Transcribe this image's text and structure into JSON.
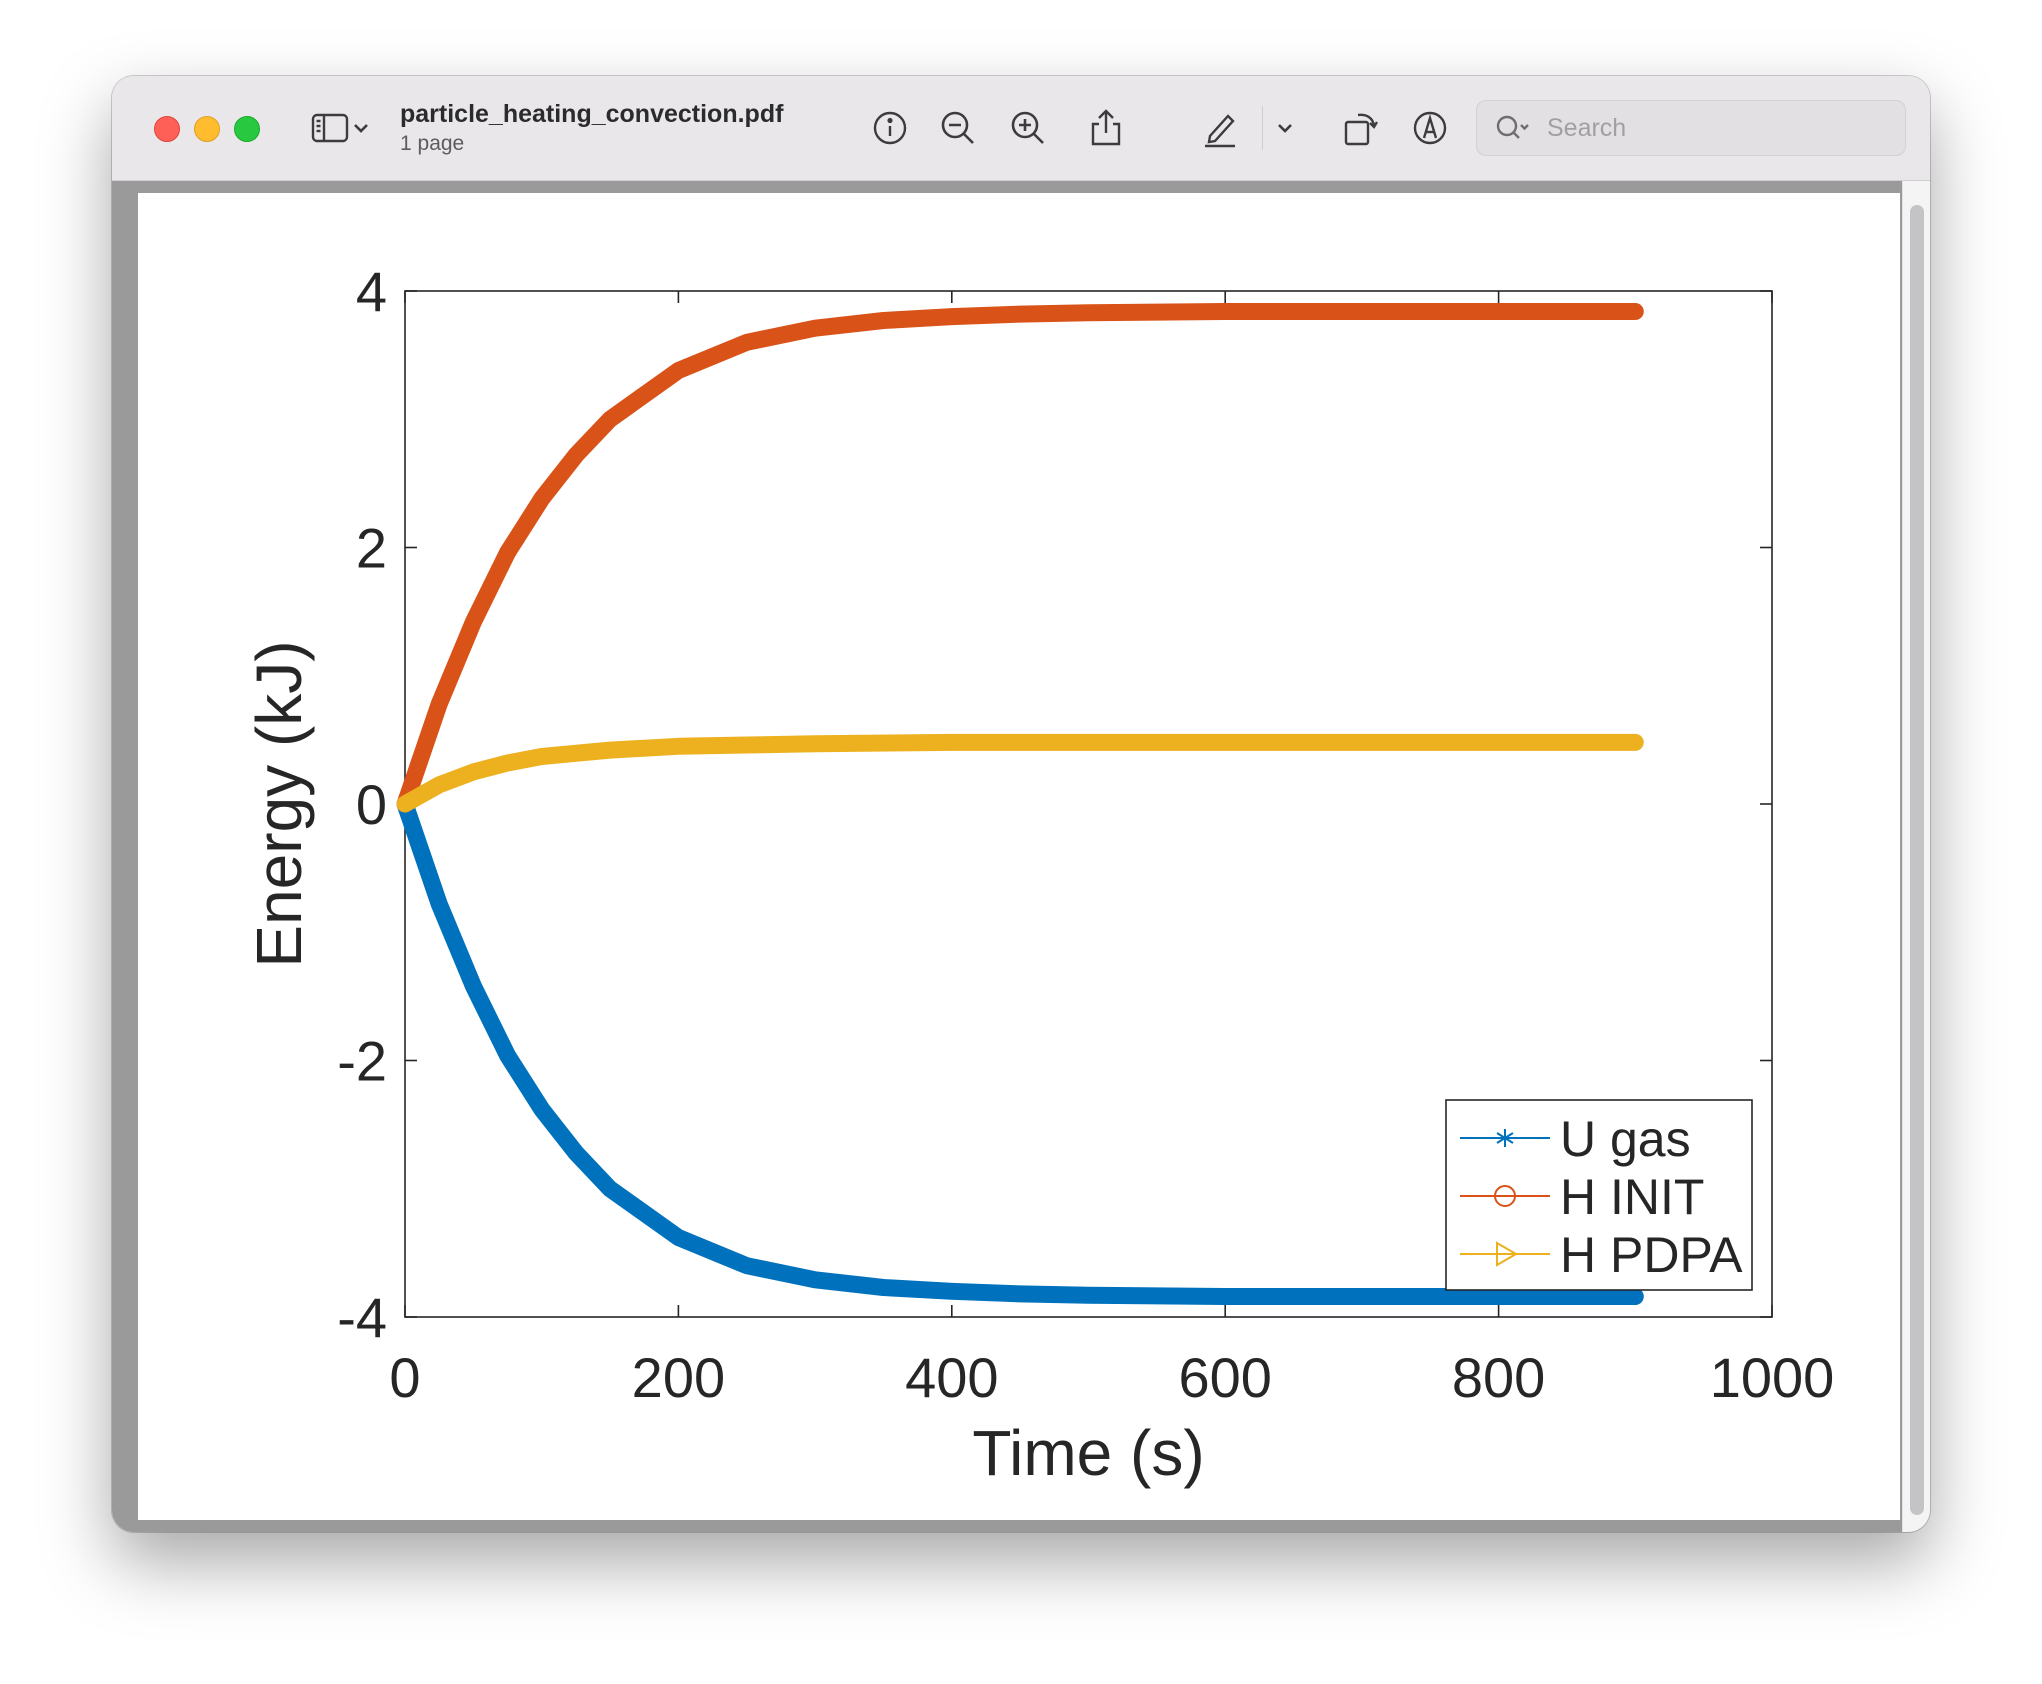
{
  "window": {
    "file_name": "particle_heating_convection.pdf",
    "page_count": "1 page"
  },
  "toolbar": {
    "icons": [
      "sidebar-icon",
      "chevron-down-icon",
      "info-icon",
      "zoom-out-icon",
      "zoom-in-icon",
      "share-icon",
      "markup-pen-icon",
      "chevron-down-icon",
      "rotate-icon",
      "annotate-icon"
    ]
  },
  "search": {
    "placeholder": "Search"
  },
  "colors": {
    "u_gas": "#0072bd",
    "h_init": "#d95319",
    "h_pdpa": "#edb120"
  },
  "chart_data": {
    "type": "line",
    "xlabel": "Time (s)",
    "ylabel": "Energy (kJ)",
    "xlim": [
      0,
      1000
    ],
    "ylim": [
      -4,
      4
    ],
    "xticks": [
      0,
      200,
      400,
      600,
      800,
      1000
    ],
    "yticks": [
      -4,
      -2,
      0,
      2,
      4
    ],
    "grid": false,
    "legend_position": "bottom-right",
    "series": [
      {
        "name": "U gas",
        "marker": "asterisk",
        "x": [
          0,
          25,
          50,
          75,
          100,
          125,
          150,
          200,
          250,
          300,
          350,
          400,
          450,
          500,
          600,
          700,
          800,
          900
        ],
        "values": [
          0,
          -0.78,
          -1.42,
          -1.96,
          -2.38,
          -2.72,
          -3.0,
          -3.38,
          -3.6,
          -3.71,
          -3.77,
          -3.8,
          -3.82,
          -3.83,
          -3.84,
          -3.84,
          -3.84,
          -3.84
        ]
      },
      {
        "name": "H INIT",
        "marker": "circle",
        "x": [
          0,
          25,
          50,
          75,
          100,
          125,
          150,
          200,
          250,
          300,
          350,
          400,
          450,
          500,
          600,
          700,
          800,
          900
        ],
        "values": [
          0,
          0.78,
          1.42,
          1.96,
          2.38,
          2.72,
          3.0,
          3.38,
          3.6,
          3.71,
          3.77,
          3.8,
          3.82,
          3.83,
          3.84,
          3.84,
          3.84,
          3.84
        ]
      },
      {
        "name": "H PDPA",
        "marker": "triangle-right",
        "x": [
          0,
          25,
          50,
          75,
          100,
          150,
          200,
          250,
          300,
          400,
          500,
          600,
          700,
          800,
          900
        ],
        "values": [
          0,
          0.15,
          0.25,
          0.32,
          0.37,
          0.42,
          0.45,
          0.46,
          0.47,
          0.48,
          0.48,
          0.48,
          0.48,
          0.48,
          0.48
        ]
      }
    ]
  }
}
